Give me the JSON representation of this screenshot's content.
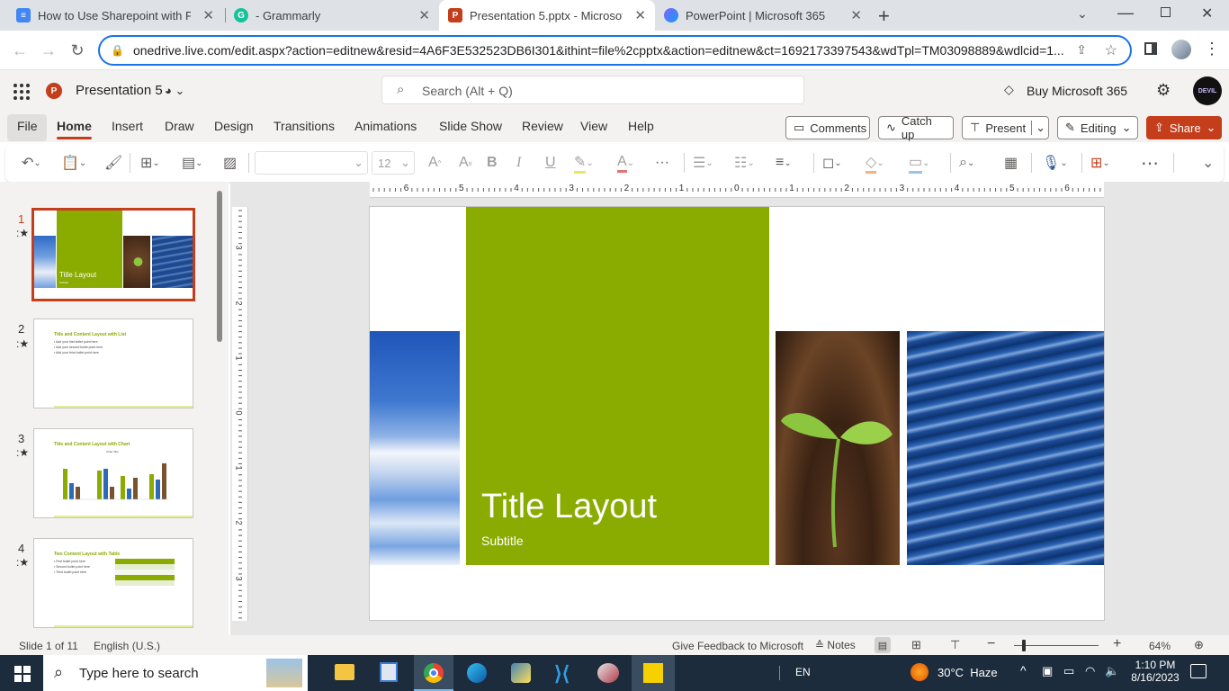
{
  "browser": {
    "tabs": [
      {
        "title": "How to Use Sharepoint with Pow",
        "icon": "docs-icon",
        "color": "#4285f4"
      },
      {
        "title": "- Grammarly",
        "icon": "grammarly-icon",
        "color": "#15c39a"
      },
      {
        "title": "Presentation 5.pptx - Microsoft P",
        "icon": "powerpoint-icon",
        "color": "#c43e1c"
      },
      {
        "title": "PowerPoint | Microsoft 365",
        "icon": "m365-icon",
        "color": "#7b61ff"
      }
    ],
    "url": "onedrive.live.com/edit.aspx?action=editnew&resid=4A6F3E532523DB6I301&ithint=file%2cpptx&action=editnew&ct=1692173397543&wdTpl=TM03098889&wdlcid=1..."
  },
  "app": {
    "doc_title": "Presentation 5",
    "search_placeholder": "Search (Alt + Q)",
    "buy_label": "Buy Microsoft 365",
    "avatar_text": "DEVIL"
  },
  "ribbon_tabs": [
    "File",
    "Home",
    "Insert",
    "Draw",
    "Design",
    "Transitions",
    "Animations",
    "Slide Show",
    "Review",
    "View",
    "Help"
  ],
  "header_buttons": {
    "comments": "Comments",
    "catchup": "Catch up",
    "present": "Present",
    "editing": "Editing",
    "share": "Share"
  },
  "toolbar": {
    "font_size": "12"
  },
  "ruler": {
    "h_labels": [
      "6",
      "5",
      "4",
      "3",
      "2",
      "1",
      "0",
      "1",
      "2",
      "3",
      "4",
      "5",
      "6"
    ],
    "v_labels": [
      "3",
      "2",
      "1",
      "0",
      "1",
      "2",
      "3"
    ]
  },
  "slides": [
    {
      "num": "1",
      "title": "Title Layout",
      "subtitle": "Subtitle"
    },
    {
      "num": "2",
      "title": "Title and Content Layout with List",
      "bullets": [
        "Add your first bullet point here",
        "Add your second bullet point here",
        "Add your third bullet point here"
      ]
    },
    {
      "num": "3",
      "title": "Title and Content Layout with Chart",
      "chart_title": "Chart Title"
    },
    {
      "num": "4",
      "title": "Two Content Layout with Table",
      "bullets": [
        "First bullet point here",
        "Second bullet point here",
        "Third bullet point here"
      ]
    }
  ],
  "slide": {
    "title": "Title Layout",
    "subtitle": "Subtitle"
  },
  "status": {
    "slide_info": "Slide 1 of 11",
    "language": "English (U.S.)",
    "feedback": "Give Feedback to Microsoft",
    "notes": "Notes",
    "zoom": "64%"
  },
  "taskbar": {
    "search_placeholder": "Type here to search",
    "lang": "EN",
    "weather": "30°C  Haze",
    "time": "1:10 PM",
    "date": "8/16/2023"
  },
  "colors": {
    "accent_green": "#8aab00",
    "office_red": "#c43e1c",
    "chrome_blue": "#1a73e8"
  }
}
